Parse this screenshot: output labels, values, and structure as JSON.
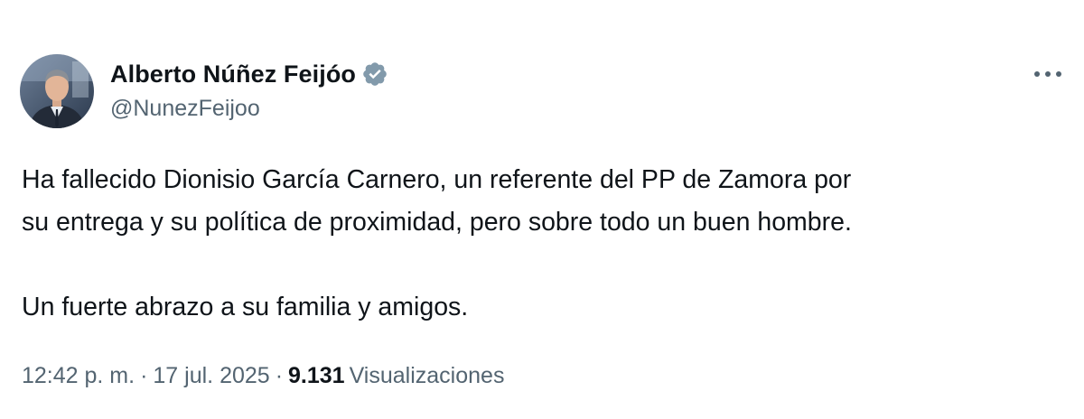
{
  "author": {
    "display_name": "Alberto Núñez Feijóo",
    "handle": "@NunezFeijoo",
    "verified": true,
    "verified_color": "#829aab",
    "avatar_icon": "profile-photo"
  },
  "menu": {
    "more_icon": "ellipsis-icon"
  },
  "tweet": {
    "paragraphs": [
      "Ha fallecido Dionisio García Carnero, un referente del PP de Zamora por",
      "su entrega y su política de proximidad, pero sobre todo un buen hombre.",
      "Un fuerte abrazo a su familia y amigos."
    ]
  },
  "meta": {
    "time": "12:42 p. m.",
    "separator": "·",
    "date": "17 jul. 2025",
    "views_count": "9.131",
    "views_label": "Visualizaciones"
  },
  "colors": {
    "text_primary": "#0f1419",
    "text_secondary": "#536471"
  }
}
